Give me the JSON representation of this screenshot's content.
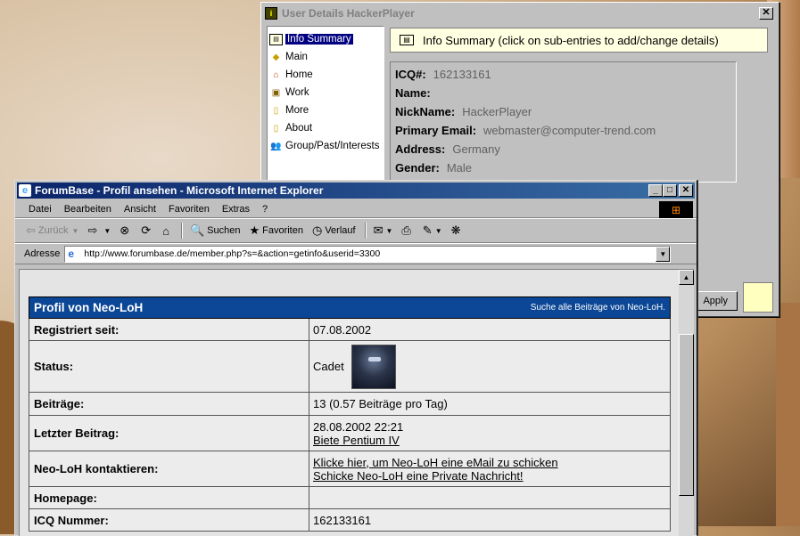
{
  "icq": {
    "title": "User Details HackerPlayer",
    "tree": [
      {
        "label": "Info Summary",
        "icon": "summary-icon",
        "selected": true
      },
      {
        "label": "Main",
        "icon": "main-icon"
      },
      {
        "label": "Home",
        "icon": "home-icon"
      },
      {
        "label": "Work",
        "icon": "work-icon"
      },
      {
        "label": "More",
        "icon": "more-icon"
      },
      {
        "label": "About",
        "icon": "about-icon"
      },
      {
        "label": "Group/Past/Interests",
        "icon": "group-icon"
      }
    ],
    "header": "Info Summary (click on sub-entries to add/change details)",
    "info": {
      "icq_label": "ICQ#:",
      "icq_value": "162133161",
      "name_label": "Name:",
      "name_value": "",
      "nick_label": "NickName:",
      "nick_value": "HackerPlayer",
      "email_label": "Primary Email:",
      "email_value": "webmaster@computer-trend.com",
      "address_label": "Address:",
      "address_value": "Germany",
      "gender_label": "Gender:",
      "gender_value": "Male"
    },
    "apply_label": "Apply"
  },
  "ie": {
    "title": "ForumBase - Profil ansehen - Microsoft Internet Explorer",
    "menu": [
      "Datei",
      "Bearbeiten",
      "Ansicht",
      "Favoriten",
      "Extras",
      "?"
    ],
    "toolbar": {
      "back": "Zurück",
      "search": "Suchen",
      "favorites": "Favoriten",
      "history": "Verlauf"
    },
    "address_label": "Adresse",
    "url": "http://www.forumbase.de/member.php?s=&action=getinfo&userid=3300"
  },
  "profile": {
    "title": "Profil von Neo-LoH",
    "search_link": "Suche alle Beiträge von Neo-LoH.",
    "registered_label": "Registriert seit:",
    "registered_value": "07.08.2002",
    "status_label": "Status:",
    "status_value": "Cadet",
    "posts_label": "Beiträge:",
    "posts_value": "13 (0.57 Beiträge pro Tag)",
    "last_post_label": "Letzter Beitrag:",
    "last_post_date": "28.08.2002 22:21",
    "last_post_link": "Biete Pentium IV",
    "contact_label": "Neo-LoH kontaktieren:",
    "contact_email": "Klicke hier, um Neo-LoH eine eMail zu schicken",
    "contact_pm": "Schicke Neo-LoH eine Private Nachricht!",
    "homepage_label": "Homepage:",
    "homepage_value": "",
    "icq_label": "ICQ Nummer:",
    "icq_value": "162133161"
  }
}
